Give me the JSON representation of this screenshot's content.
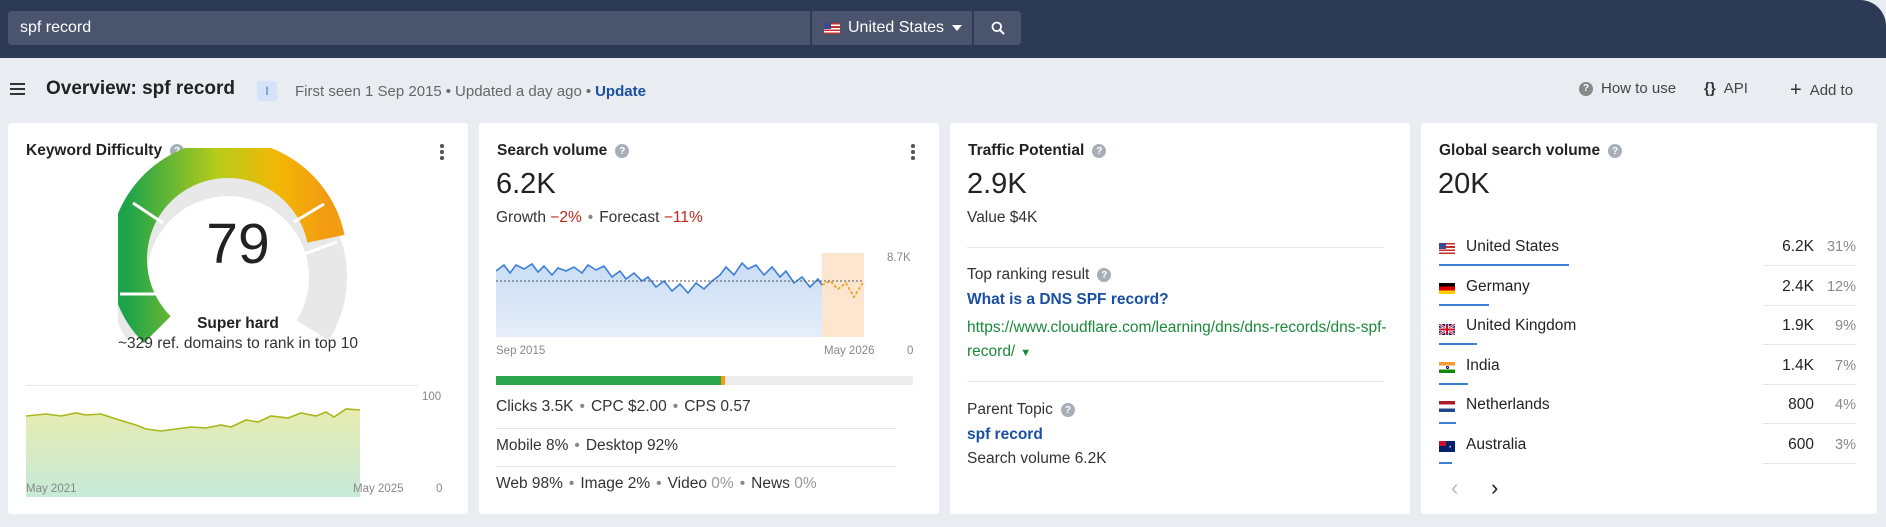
{
  "search": {
    "query": "spf record"
  },
  "country": {
    "selected": "United States"
  },
  "header": {
    "title": "Overview: spf record",
    "intent_badge": "I",
    "first_seen": "First seen 1 Sep 2015",
    "updated": "Updated a day ago",
    "update_link": "Update",
    "how_to_use": "How to use",
    "api": "API",
    "add_to": "Add to"
  },
  "kd": {
    "title": "Keyword Difficulty",
    "value": "79",
    "value_fraction": 0.79,
    "label": "Super hard",
    "description": "~329 ref. domains to rank in top 10",
    "chart_y_max": "100",
    "chart_y_min": "0",
    "chart_start": "May 2021",
    "chart_end": "May 2025"
  },
  "sv": {
    "title": "Search volume",
    "value": "6.2K",
    "growth_label": "Growth",
    "growth_value": "−2%",
    "forecast_label": "Forecast",
    "forecast_value": "−11%",
    "chart_y_max": "8.7K",
    "chart_y_min": "0",
    "chart_start": "Sep 2015",
    "chart_end": "May 2026",
    "clicks": "Clicks 3.5K",
    "cpc": "CPC $2.00",
    "cps": "CPS 0.57",
    "mobile": "Mobile 8%",
    "desktop": "Desktop 92%",
    "web": "Web 98%",
    "image": "Image 2%",
    "video_label": "Video",
    "video_value": "0%",
    "news_label": "News",
    "news_value": "0%",
    "serp_bar": {
      "green": 0.54,
      "orange": 0.01
    }
  },
  "tp": {
    "title": "Traffic Potential",
    "value": "2.9K",
    "value_line": "Value $4K",
    "top_result_label": "Top ranking result",
    "top_result_title": "What is a DNS SPF record?",
    "top_result_url": "https://www.cloudflare.com/learning/dns/dns-records/dns-spf-record/",
    "parent_label": "Parent Topic",
    "parent_link": "spf record",
    "parent_volume": "Search volume 6.2K"
  },
  "gsv": {
    "title": "Global search volume",
    "value": "20K",
    "countries": [
      {
        "name": "United States",
        "volume": "6.2K",
        "share": "31%",
        "share_fraction": 0.31,
        "flag": "us-flag"
      },
      {
        "name": "Germany",
        "volume": "2.4K",
        "share": "12%",
        "share_fraction": 0.12,
        "flag": "de-flag"
      },
      {
        "name": "United Kingdom",
        "volume": "1.9K",
        "share": "9%",
        "share_fraction": 0.09,
        "flag": "gb-flag"
      },
      {
        "name": "India",
        "volume": "1.4K",
        "share": "7%",
        "share_fraction": 0.07,
        "flag": "in-flag"
      },
      {
        "name": "Netherlands",
        "volume": "800",
        "share": "4%",
        "share_fraction": 0.04,
        "flag": "nl-flag"
      },
      {
        "name": "Australia",
        "volume": "600",
        "share": "3%",
        "share_fraction": 0.03,
        "flag": "au-flag"
      }
    ]
  },
  "colors": {
    "topbar": "#2d3a55",
    "link_blue": "#1a4fa3",
    "link_green": "#1b8a3a",
    "negative": "#c0281c",
    "chart_blue": "#3d7fd8"
  }
}
